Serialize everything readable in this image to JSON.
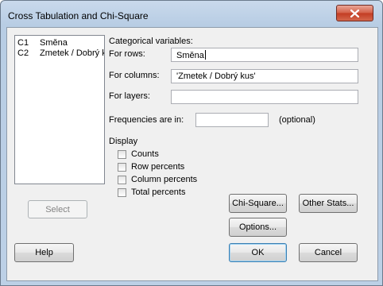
{
  "dialog": {
    "title": "Cross Tabulation and Chi-Square"
  },
  "variables": [
    {
      "num": "C1",
      "name": "Směna"
    },
    {
      "num": "C2",
      "name": "Zmetek / Dobrý k"
    }
  ],
  "categorical": {
    "heading": "Categorical variables:",
    "rows_label": "For rows:",
    "rows_value": "Směna",
    "columns_label": "For columns:",
    "columns_value": "'Zmetek / Dobrý kus'",
    "layers_label": "For layers:",
    "layers_value": ""
  },
  "frequencies": {
    "label": "Frequencies are in:",
    "value": "",
    "optional": "(optional)"
  },
  "display": {
    "heading": "Display",
    "options": [
      {
        "label": "Counts",
        "checked": false
      },
      {
        "label": "Row percents",
        "checked": false
      },
      {
        "label": "Column percents",
        "checked": false
      },
      {
        "label": "Total percents",
        "checked": false
      }
    ]
  },
  "buttons": {
    "select": "Select",
    "chi_square": "Chi-Square...",
    "other_stats": "Other Stats...",
    "options": "Options...",
    "help": "Help",
    "ok": "OK",
    "cancel": "Cancel"
  }
}
